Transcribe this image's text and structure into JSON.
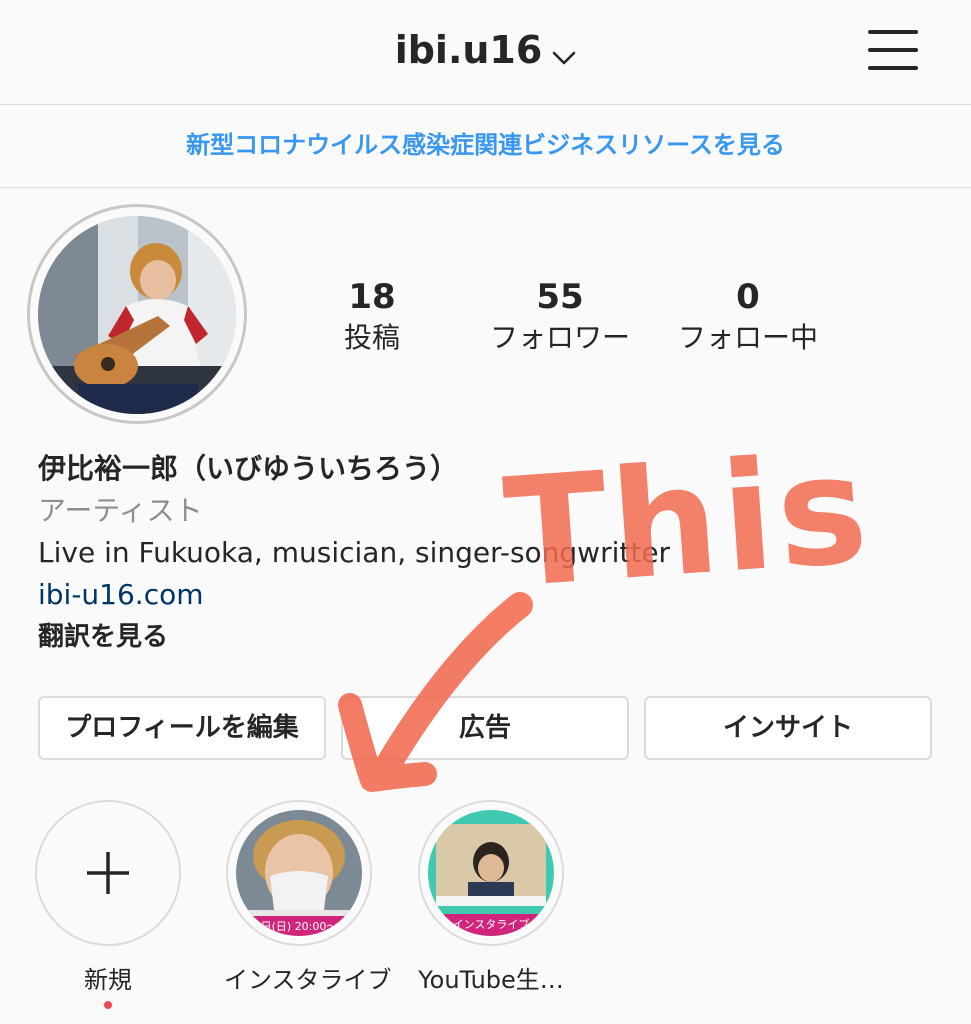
{
  "header": {
    "username": "ibi.u16",
    "menu_icon": "hamburger-menu-icon",
    "chevron_icon": "chevron-down-icon"
  },
  "banner": {
    "text": "新型コロナウイルス感染症関連ビジネスリソースを見る",
    "color": "#3897f0"
  },
  "stats": [
    {
      "value": "18",
      "label": "投稿"
    },
    {
      "value": "55",
      "label": "フォロワー"
    },
    {
      "value": "0",
      "label": "フォロー中"
    }
  ],
  "profile": {
    "name": "伊比裕一郎（いびゆういちろう）",
    "category": "アーティスト",
    "bio": "Live in Fukuoka, musician, singer-songwritter",
    "link": "ibi-u16.com",
    "translate": "翻訳を見る"
  },
  "buttons": {
    "edit_profile": "プロフィールを編集",
    "ads": "広告",
    "insights": "インサイト"
  },
  "highlights": [
    {
      "label": "新規",
      "icon": "plus-icon"
    },
    {
      "label": "インスタライブ",
      "overlay_text": "日(日) 20:00〜"
    },
    {
      "label": "YouTube生…",
      "overlay_text": "インスタライブ"
    }
  ],
  "annotation": {
    "text": "This",
    "color": "#f26b4f"
  }
}
